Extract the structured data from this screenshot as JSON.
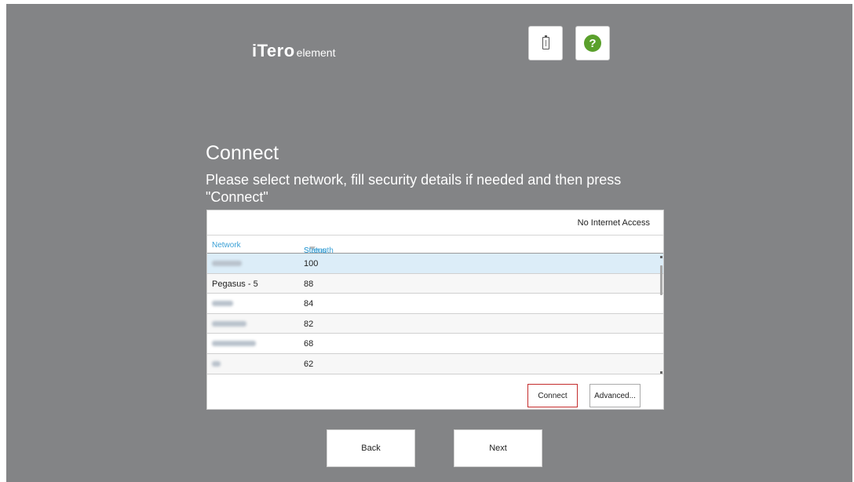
{
  "app": {
    "brand": "iTero",
    "brand_sub": "element"
  },
  "header": {
    "battery_icon": "battery-charging-icon",
    "help_icon": "help-icon",
    "help_glyph": "?"
  },
  "page": {
    "title": "Connect",
    "instructions": "Please select network, fill security details if needed and then press \"Connect\""
  },
  "network_panel": {
    "internet_status": "No Internet Access",
    "columns": {
      "network": "Network",
      "strength": "Strength",
      "status": "Status"
    },
    "networks": [
      {
        "name": "",
        "strength": "100"
      },
      {
        "name": "Pegasus - 5",
        "strength": "88"
      },
      {
        "name": "",
        "strength": "84"
      },
      {
        "name": "",
        "strength": "82"
      },
      {
        "name": "",
        "strength": "68"
      },
      {
        "name": "",
        "strength": "62"
      }
    ],
    "connect_label": "Connect",
    "advanced_label": "Advanced..."
  },
  "footer": {
    "back_label": "Back",
    "next_label": "Next"
  },
  "colors": {
    "background": "#838486",
    "column_header": "#3aa0d6",
    "selected_row": "#dcedf8",
    "connect_border": "#c42c2c",
    "help_green": "#5aa02c"
  }
}
